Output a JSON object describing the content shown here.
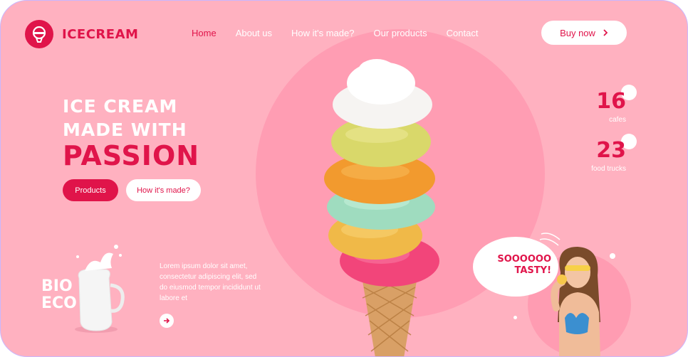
{
  "brand": {
    "name": "ICECREAM"
  },
  "nav": {
    "items": [
      {
        "label": "Home"
      },
      {
        "label": "About us"
      },
      {
        "label": "How it's made?"
      },
      {
        "label": "Our products"
      },
      {
        "label": "Contact"
      }
    ]
  },
  "header": {
    "buy_label": "Buy now"
  },
  "hero": {
    "line1": "ICE CREAM",
    "line2": "MADE WITH",
    "line3": "PASSION",
    "products_label": "Products",
    "how_label": "How it's made?"
  },
  "stats": [
    {
      "value": "16",
      "label": "cafes"
    },
    {
      "value": "23",
      "label": "food trucks"
    }
  ],
  "promo": {
    "badge_line1": "BIO",
    "badge_line2": "ECO",
    "text": "Lorem ipsum dolor sit amet, consectetur adipiscing elit, sed do eiusmod tempor incididunt ut labore et"
  },
  "bubble": {
    "line1": "SOOOOOO",
    "line2": "TASTY!"
  },
  "colors": {
    "accent": "#e0144a",
    "background": "#ffb1c0",
    "circle": "#ff9db3"
  },
  "icons": [
    "ice-cream-logo-icon",
    "chevron-right-icon",
    "arrow-right-icon"
  ]
}
